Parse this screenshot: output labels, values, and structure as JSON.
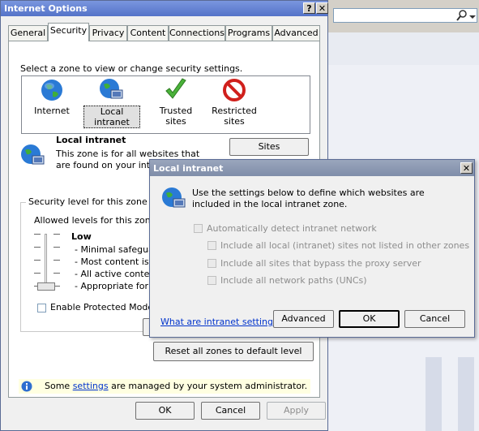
{
  "background_window": {
    "search_icon": "search-icon",
    "dropdown_icon": "chevron-down-icon"
  },
  "internet_options": {
    "title": "Internet Options",
    "help_btn": "?",
    "close_btn": "✕",
    "tabs": [
      "General",
      "Security",
      "Privacy",
      "Content",
      "Connections",
      "Programs",
      "Advanced"
    ],
    "active_tab": "Security",
    "zone_prompt": "Select a zone to view or change security settings.",
    "zones": [
      {
        "label": "Internet",
        "icon": "globe-icon"
      },
      {
        "label": "Local intranet",
        "icon": "intranet-globe-icon"
      },
      {
        "label": "Trusted sites",
        "icon": "checkmark-icon"
      },
      {
        "label": "Restricted sites",
        "icon": "restricted-icon"
      }
    ],
    "selected_zone_title": "Local intranet",
    "selected_zone_desc": "This zone is for all websites that are found on your intranet.",
    "sites_btn": "Sites",
    "security_level_group": "Security level for this zone",
    "allowed_levels": "Allowed levels for this zone: A",
    "level_name": "Low",
    "level_items": [
      "- Minimal safeguar",
      "- Most content is r",
      "- All active conten",
      "- Appropriate for s"
    ],
    "protected_mode": "Enable Protected Mode (",
    "reset_all_btn": "Reset all zones to default level",
    "info_prefix": "Some ",
    "info_link": "settings",
    "info_suffix": " are managed by your system administrator.",
    "ok_btn": "OK",
    "cancel_btn": "Cancel",
    "apply_btn": "Apply"
  },
  "local_intranet_dialog": {
    "title": "Local intranet",
    "close_btn": "✕",
    "description": "Use the settings below to define which websites are included in the local intranet zone.",
    "auto_detect": "Automatically detect intranet network",
    "options": [
      "Include all local (intranet) sites not listed in other zones",
      "Include all sites that bypass the proxy server",
      "Include all network paths (UNCs)"
    ],
    "help_link": "What are intranet settings?",
    "advanced_btn": "Advanced",
    "ok_btn": "OK",
    "cancel_btn": "Cancel"
  },
  "colors": {
    "titlebar": "#5f7ed0",
    "dialog_bg": "#f0f0f0",
    "link": "#0033cc",
    "info_bar": "#ffffe1"
  }
}
